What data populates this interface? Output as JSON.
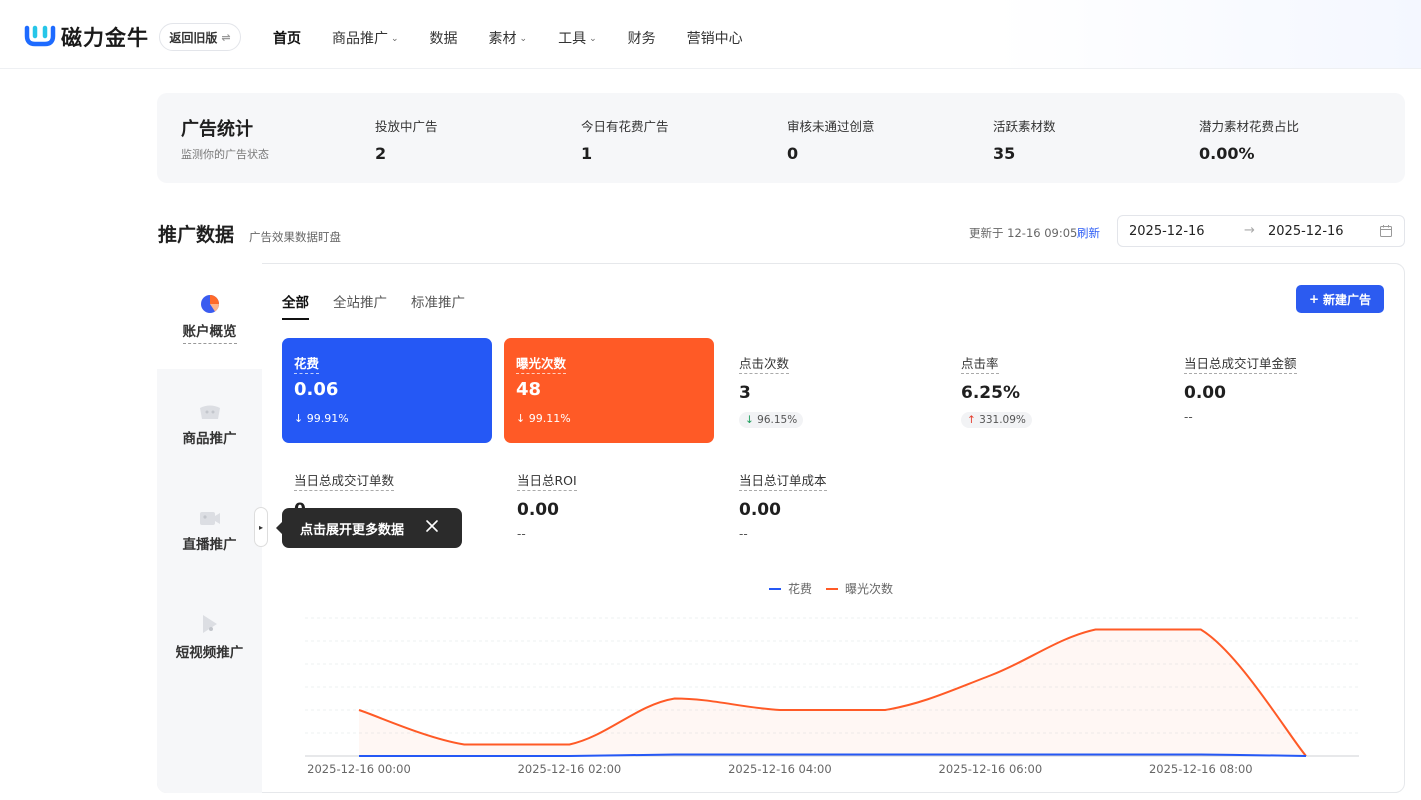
{
  "brand": {
    "name": "磁力金牛",
    "old_version": "返回旧版",
    "switch_glyph": "⇌"
  },
  "nav": [
    {
      "label": "首页",
      "dropdown": false,
      "active": true
    },
    {
      "label": "商品推广",
      "dropdown": true
    },
    {
      "label": "数据",
      "dropdown": false
    },
    {
      "label": "素材",
      "dropdown": true
    },
    {
      "label": "工具",
      "dropdown": true
    },
    {
      "label": "财务",
      "dropdown": false
    },
    {
      "label": "营销中心",
      "dropdown": false
    }
  ],
  "ad_stats": {
    "title": "广告统计",
    "subtitle": "监测你的广告状态",
    "items": [
      {
        "label": "投放中广告",
        "value": "2"
      },
      {
        "label": "今日有花费广告",
        "value": "1"
      },
      {
        "label": "审核未通过创意",
        "value": "0"
      },
      {
        "label": "活跃素材数",
        "value": "35"
      },
      {
        "label": "潜力素材花费占比",
        "value": "0.00%"
      }
    ]
  },
  "promo": {
    "title": "推广数据",
    "subtitle": "广告效果数据盯盘",
    "updated": "更新于 12-16 09:05",
    "refresh": "刷新",
    "date_start": "2025-12-16",
    "date_end": "2025-12-16",
    "date_arrow": "→"
  },
  "left_nav": [
    {
      "label": "账户概览",
      "icon": "pie-chart-icon",
      "active": true
    },
    {
      "label": "商品推广",
      "icon": "goods-icon"
    },
    {
      "label": "直播推广",
      "icon": "live-camera-icon"
    },
    {
      "label": "短视频推广",
      "icon": "video-play-icon"
    }
  ],
  "tabs": [
    {
      "label": "全部",
      "active": true
    },
    {
      "label": "全站推广"
    },
    {
      "label": "标准推广"
    }
  ],
  "new_ad": {
    "icon": "+",
    "label": "新建广告"
  },
  "cards": [
    {
      "label": "花费",
      "value": "0.06",
      "change": "↓ 99.91%",
      "color": "#2558f5"
    },
    {
      "label": "曝光次数",
      "value": "48",
      "change": "↓ 99.11%",
      "color": "#ff5a26"
    }
  ],
  "metrics": [
    {
      "label": "点击次数",
      "value": "3",
      "arrow": "↓",
      "change": "96.15%",
      "dir": "down"
    },
    {
      "label": "点击率",
      "value": "6.25%",
      "arrow": "↑",
      "change": "331.09%",
      "dir": "up"
    },
    {
      "label": "当日总成交订单金额",
      "value": "0.00",
      "dash": "--"
    },
    {
      "label": "当日总成交订单数",
      "value": "0"
    },
    {
      "label": "当日总ROI",
      "value": "0.00",
      "dash": "--"
    },
    {
      "label": "当日总订单成本",
      "value": "0.00",
      "dash": "--"
    }
  ],
  "tooltip": {
    "text": "点击展开更多数据",
    "close": "✕"
  },
  "expand_glyph": "▸",
  "colors": {
    "accent": "#2c5bf0",
    "spend": "#2558f5",
    "exposure": "#ff5a26"
  },
  "chart_data": {
    "type": "line",
    "x": [
      "2025-12-16 00:00",
      "2025-12-16 01:00",
      "2025-12-16 02:00",
      "2025-12-16 03:00",
      "2025-12-16 04:00",
      "2025-12-16 05:00",
      "2025-12-16 06:00",
      "2025-12-16 07:00",
      "2025-12-16 08:00",
      "2025-12-16 09:00"
    ],
    "tick_labels": [
      "2025-12-16 00:00",
      "2025-12-16 02:00",
      "2025-12-16 04:00",
      "2025-12-16 06:00",
      "2025-12-16 08:00"
    ],
    "series": [
      {
        "name": "花费",
        "values": [
          0,
          0,
          0,
          0.01,
          0.01,
          0.01,
          0.01,
          0.01,
          0.01,
          0
        ],
        "color": "#2558f5",
        "axis": "right"
      },
      {
        "name": "曝光次数",
        "values": [
          4,
          1,
          1,
          5,
          4,
          4,
          7,
          11,
          11,
          0
        ],
        "color": "#ff5a26",
        "area": true,
        "axis": "left"
      }
    ],
    "ylim": [
      0,
      12
    ],
    "grid": true,
    "legend": "top-center"
  }
}
